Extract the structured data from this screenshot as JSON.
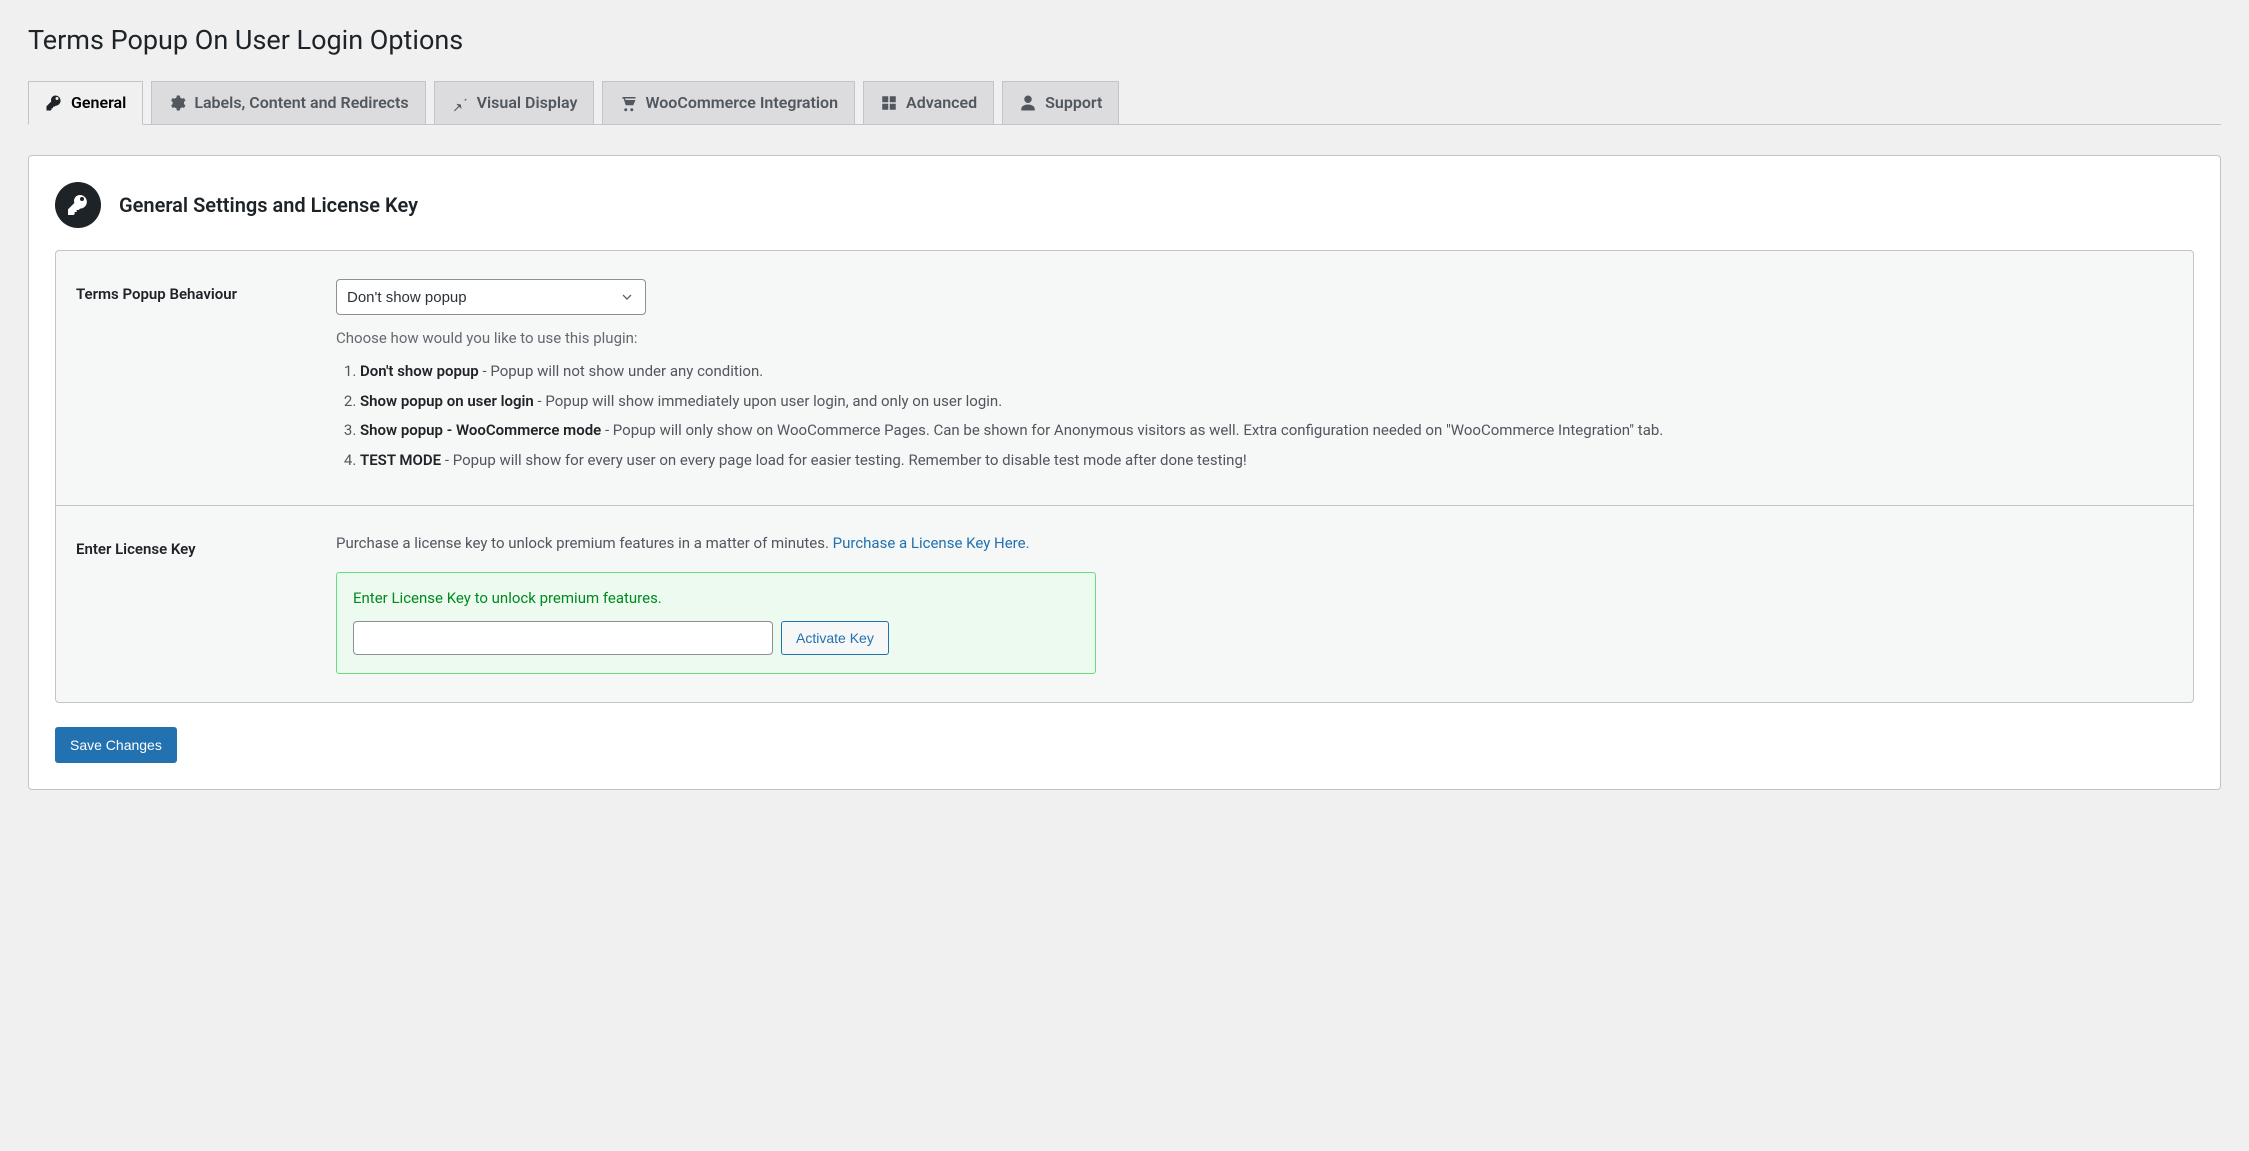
{
  "page_title": "Terms Popup On User Login Options",
  "tabs": [
    {
      "label": "General",
      "icon": "key"
    },
    {
      "label": "Labels, Content and Redirects",
      "icon": "gear"
    },
    {
      "label": "Visual Display",
      "icon": "pin"
    },
    {
      "label": "WooCommerce Integration",
      "icon": "cart"
    },
    {
      "label": "Advanced",
      "icon": "tools"
    },
    {
      "label": "Support",
      "icon": "user"
    }
  ],
  "active_tab_index": 0,
  "section": {
    "title": "General Settings and License Key"
  },
  "behaviour": {
    "label": "Terms Popup Behaviour",
    "selected": "Don't show popup",
    "description": "Choose how would you like to use this plugin:",
    "options": [
      {
        "name": "Don't show popup",
        "desc": " - Popup will not show under any condition."
      },
      {
        "name": "Show popup on user login",
        "desc": " - Popup will show immediately upon user login, and only on user login."
      },
      {
        "name": "Show popup - WooCommerce mode",
        "desc": " - Popup will only show on WooCommerce Pages. Can be shown for Anonymous visitors as well. Extra configuration needed on \"WooCommerce Integration\" tab."
      },
      {
        "name": "TEST MODE",
        "desc": " - Popup will show for every user on every page load for easier testing. Remember to disable test mode after done testing!"
      }
    ]
  },
  "license": {
    "label": "Enter License Key",
    "intro": "Purchase a license key to unlock premium features in a matter of minutes. ",
    "link_text": "Purchase a License Key Here.",
    "hint": "Enter License Key to unlock premium features.",
    "value": "",
    "activate_label": "Activate Key"
  },
  "save_label": "Save Changes"
}
